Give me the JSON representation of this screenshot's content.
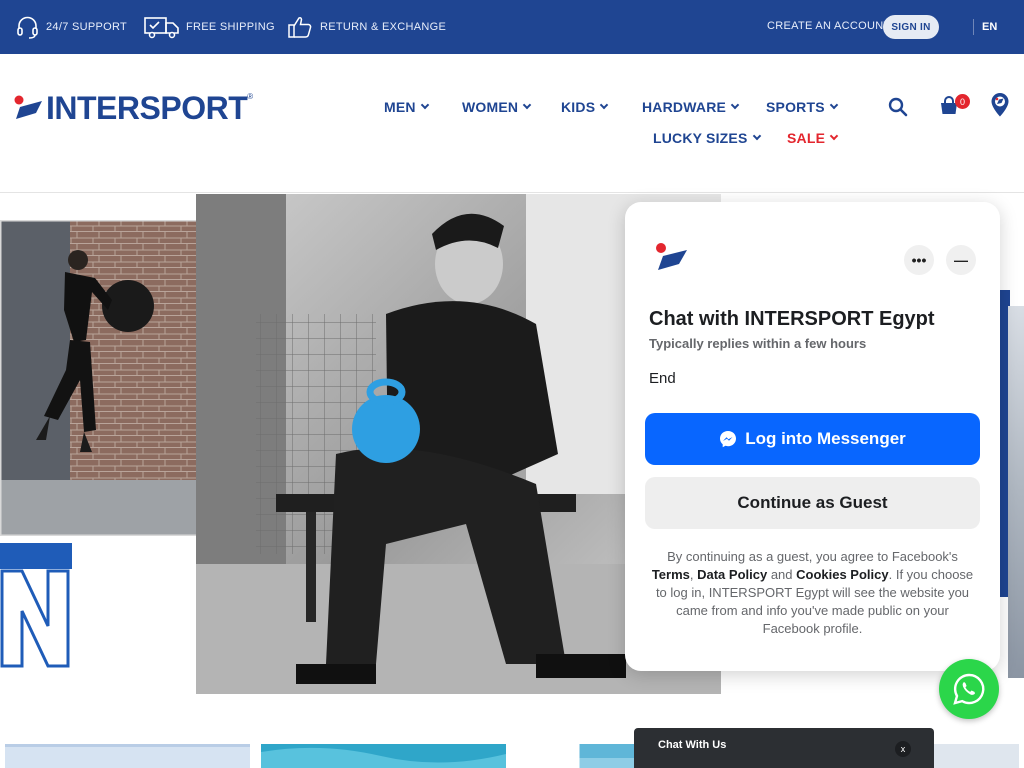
{
  "topbar": {
    "support": "24/7 SUPPORT",
    "shipping": "FREE SHIPPING",
    "returns": "RETURN & EXCHANGE",
    "create_account": "CREATE AN ACCOUNT",
    "sign_in": "SIGN IN",
    "language": "EN"
  },
  "brand": {
    "name": "INTERSPORT",
    "registered": "®"
  },
  "nav": {
    "men": "MEN",
    "women": "WOMEN",
    "kids": "KIDS",
    "hardware": "HARDWARE",
    "sports": "SPORTS",
    "lucky_sizes": "LUCKY SIZES",
    "sale": "SALE"
  },
  "cart": {
    "count": "0"
  },
  "chat": {
    "title": "Chat with INTERSPORT Egypt",
    "subtitle": "Typically replies within a few hours",
    "status": "End",
    "messenger_button": "Log into Messenger",
    "guest_button": "Continue as Guest",
    "legal_1": "By continuing as a guest, you agree to Facebook's ",
    "terms": "Terms",
    "comma": ", ",
    "data_policy": "Data Policy",
    "and": " and ",
    "cookies_policy": "Cookies Policy",
    "legal_2": ". If you choose to log in, INTERSPORT Egypt will see the website you came from and info you've made public on your Facebook profile."
  },
  "chatbar": {
    "label": "Chat With Us",
    "close": "x"
  },
  "colors": {
    "brand_blue": "#1f4592",
    "brand_red": "#e3262e",
    "messenger_blue": "#0866ff",
    "whatsapp_green": "#2bd64a"
  }
}
